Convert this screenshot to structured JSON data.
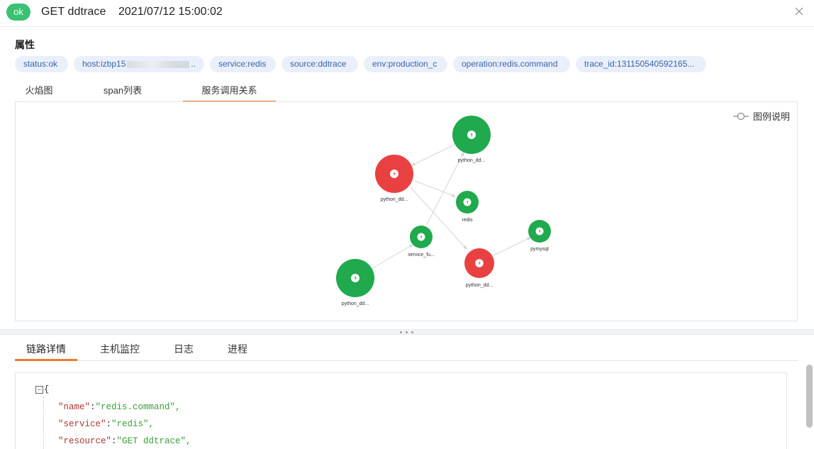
{
  "header": {
    "status_badge": "ok",
    "title": "GET ddtrace",
    "timestamp": "2021/07/12 15:00:02",
    "close_icon": "close-icon"
  },
  "attributes": {
    "title": "属性",
    "tags": [
      "status:ok",
      "host:izbp15",
      "service:redis",
      "source:ddtrace",
      "env:production_c",
      "operation:redis.command",
      "trace_id:131150540592165..."
    ],
    "host_tag_suffix": ".."
  },
  "top_tabs": [
    {
      "label": "火焰图",
      "active": false
    },
    {
      "label": "span列表",
      "active": false
    },
    {
      "label": "服务调用关系",
      "active": true
    }
  ],
  "graph": {
    "legend_toggle": "图例说明",
    "colors": {
      "ok": "#20a94d",
      "error": "#e94141",
      "edge": "#d5d5d5"
    },
    "nodes": [
      {
        "id": "n1",
        "label": "python_dd...",
        "status": "ok"
      },
      {
        "id": "n2",
        "label": "python_dd...",
        "status": "error"
      },
      {
        "id": "n3",
        "label": "redis",
        "status": "ok"
      },
      {
        "id": "n4",
        "label": "service_fu...",
        "status": "ok"
      },
      {
        "id": "n5",
        "label": "pymysql",
        "status": "ok"
      },
      {
        "id": "n6",
        "label": "python_dd...",
        "status": "error"
      },
      {
        "id": "n7",
        "label": "python_dd...",
        "status": "ok"
      }
    ]
  },
  "bottom_tabs": [
    {
      "label": "链路详情",
      "active": true
    },
    {
      "label": "主机监控",
      "active": false
    },
    {
      "label": "日志",
      "active": false
    },
    {
      "label": "进程",
      "active": false
    }
  ],
  "json_view": {
    "collapse_symbol": "⊟",
    "open_brace": "{",
    "lines": [
      {
        "key": "\"name\"",
        "value": "\"redis.command\","
      },
      {
        "key": "\"service\"",
        "value": "\"redis\","
      },
      {
        "key": "\"resource\"",
        "value": "\"GET ddtrace\","
      }
    ]
  },
  "accent_color": "#ee7b2e"
}
